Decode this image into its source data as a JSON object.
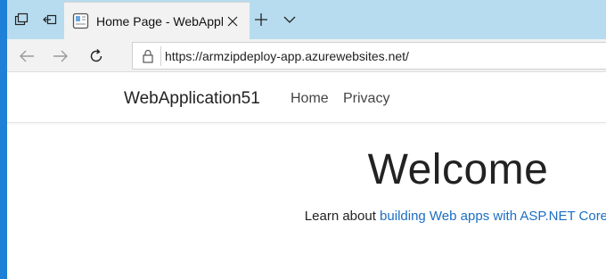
{
  "browser": {
    "tab_title": "Home Page - WebAppli",
    "url": "https://armzipdeploy-app.azurewebsites.net/",
    "icons": {
      "set_aside": "tabs-aside-icon",
      "restore": "restore-tabs-icon",
      "favicon": "page-favicon-icon",
      "close": "close-icon",
      "new_tab": "plus-icon",
      "tab_menu": "chevron-down-icon",
      "back": "back-arrow-icon",
      "forward": "forward-arrow-icon",
      "refresh": "refresh-icon",
      "lock": "lock-icon"
    }
  },
  "site": {
    "brand": "WebApplication51",
    "nav": [
      "Home",
      "Privacy"
    ],
    "heading": "Welcome",
    "lead_prefix": "Learn about ",
    "lead_link": "building Web apps with ASP.NET Core",
    "lead_suffix": ".",
    "link_color": "#1b6ec2"
  },
  "colors": {
    "desktop": "#1f80d8",
    "tabstrip": "#b8dcef",
    "active_tab": "#f2f2f2"
  }
}
